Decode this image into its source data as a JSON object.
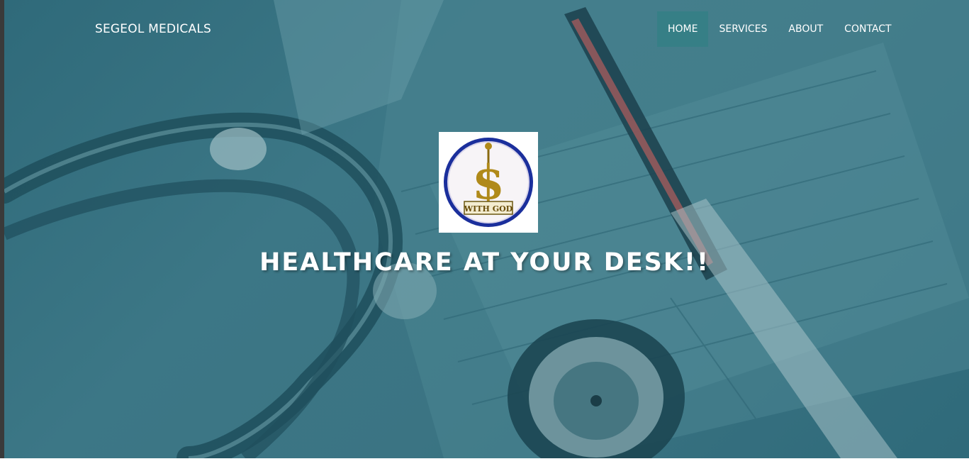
{
  "brand": {
    "name": "SEGEOL MEDICALS"
  },
  "nav": {
    "items": [
      {
        "label": "HOME",
        "active": true
      },
      {
        "label": "SERVICES",
        "active": false
      },
      {
        "label": "ABOUT",
        "active": false
      },
      {
        "label": "CONTACT",
        "active": false
      }
    ]
  },
  "hero": {
    "logo_symbol": "$",
    "logo_text": "WITH GOD",
    "headline": "HEALTHCARE AT YOUR DESK!!"
  },
  "colors": {
    "overlay": "#3b7483",
    "nav_active": "#367f86",
    "logo_ring": "#1b2f9c",
    "logo_gold": "#b08a1a"
  }
}
